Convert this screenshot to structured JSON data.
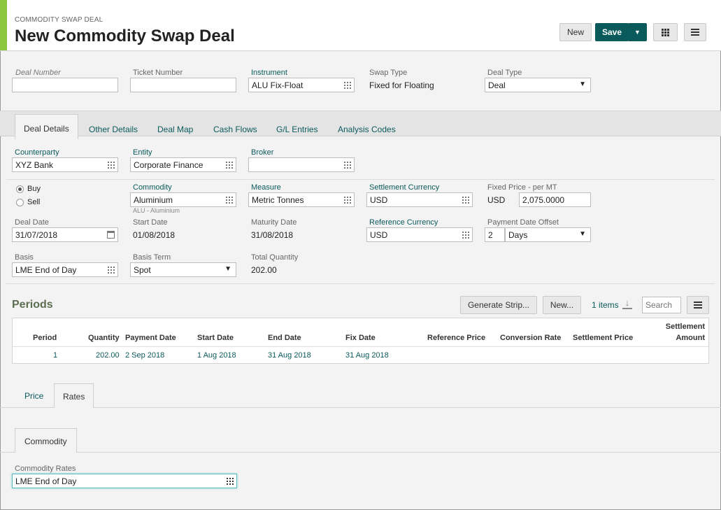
{
  "header": {
    "breadcrumb": "COMMODITY SWAP DEAL",
    "title": "New Commodity Swap Deal",
    "new_label": "New",
    "save_label": "Save"
  },
  "top_fields": {
    "deal_number": {
      "label": "Deal Number",
      "value": ""
    },
    "ticket_number": {
      "label": "Ticket Number",
      "value": ""
    },
    "instrument": {
      "label": "Instrument",
      "value": "ALU Fix-Float"
    },
    "swap_type": {
      "label": "Swap Type",
      "value": "Fixed for Floating"
    },
    "deal_type": {
      "label": "Deal Type",
      "value": "Deal"
    }
  },
  "tabs": [
    "Deal Details",
    "Other Details",
    "Deal Map",
    "Cash Flows",
    "G/L Entries",
    "Analysis Codes"
  ],
  "details": {
    "counterparty": {
      "label": "Counterparty",
      "value": "XYZ Bank"
    },
    "entity": {
      "label": "Entity",
      "value": "Corporate Finance"
    },
    "broker": {
      "label": "Broker",
      "value": ""
    },
    "buy_label": "Buy",
    "sell_label": "Sell",
    "commodity": {
      "label": "Commodity",
      "value": "Aluminium",
      "hint": "ALU - Aluminium"
    },
    "measure": {
      "label": "Measure",
      "value": "Metric Tonnes"
    },
    "settlement_currency": {
      "label": "Settlement Currency",
      "value": "USD"
    },
    "fixed_price": {
      "label": "Fixed Price - per MT",
      "currency": "USD",
      "value": "2,075.0000"
    },
    "deal_date": {
      "label": "Deal Date",
      "value": "31/07/2018"
    },
    "start_date": {
      "label": "Start Date",
      "value": "01/08/2018"
    },
    "maturity_date": {
      "label": "Maturity Date",
      "value": "31/08/2018"
    },
    "reference_currency": {
      "label": "Reference Currency",
      "value": "USD"
    },
    "payment_offset": {
      "label": "Payment Date Offset",
      "number": "2",
      "unit": "Days"
    },
    "basis": {
      "label": "Basis",
      "value": "LME End of Day"
    },
    "basis_term": {
      "label": "Basis Term",
      "value": "Spot"
    },
    "total_quantity": {
      "label": "Total Quantity",
      "value": "202.00"
    }
  },
  "periods": {
    "title": "Periods",
    "generate_label": "Generate Strip...",
    "new_label": "New...",
    "count_label": "1 items",
    "search_placeholder": "Search",
    "columns": [
      "Period",
      "Quantity",
      "Payment Date",
      "Start Date",
      "End Date",
      "Fix Date",
      "Reference Price",
      "Conversion Rate",
      "Settlement Price",
      "Settlement",
      "Amount"
    ],
    "row": {
      "period": "1",
      "quantity": "202.00",
      "payment_date": "2 Sep 2018",
      "start_date": "1 Aug 2018",
      "end_date": "31 Aug 2018",
      "fix_date": "31 Aug 2018"
    }
  },
  "bottom_tabs": [
    "Price",
    "Rates"
  ],
  "rates_tab": "Commodity",
  "commodity_rates": {
    "label": "Commodity Rates",
    "value": "LME End of Day"
  }
}
